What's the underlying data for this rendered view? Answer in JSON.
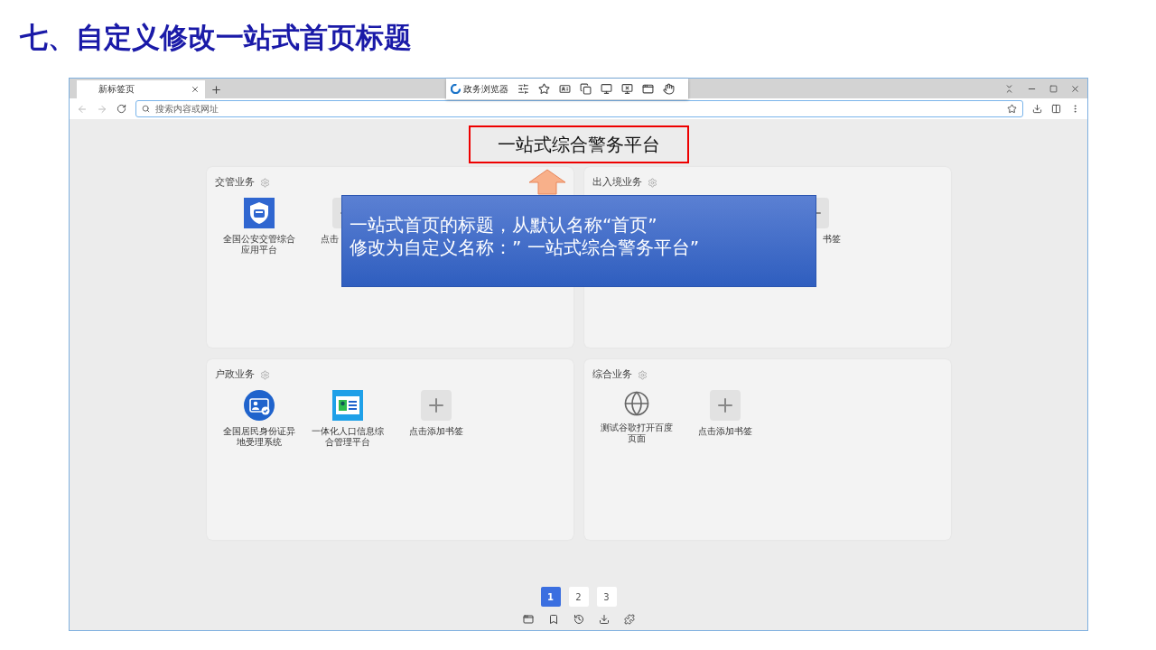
{
  "slide_title": "七、自定义修改一站式首页标题",
  "browser": {
    "tab": {
      "title": "新标签页",
      "selected": true
    },
    "toolbar": {
      "brand": "政务浏览器"
    },
    "address": {
      "placeholder": "搜索内容或网址"
    }
  },
  "page": {
    "title": "一站式综合警务平台",
    "cards": [
      {
        "title": "交管业务",
        "items": [
          {
            "kind": "shield",
            "label": "全国公安交管综合应用平台"
          },
          {
            "kind": "add",
            "label": "点击"
          }
        ]
      },
      {
        "title": "出入境业务",
        "items": [
          {
            "kind": "add",
            "label": "书签"
          }
        ]
      },
      {
        "title": "户政业务",
        "items": [
          {
            "kind": "idcard",
            "label": "全国居民身份证异地受理系统"
          },
          {
            "kind": "profile",
            "label": "一体化人口信息综合管理平台"
          },
          {
            "kind": "add",
            "label": "点击添加书签"
          }
        ]
      },
      {
        "title": "综合业务",
        "items": [
          {
            "kind": "globe",
            "label": "测试谷歌打开百度页面"
          },
          {
            "kind": "add",
            "label": "点击添加书签"
          }
        ]
      }
    ],
    "pagination": [
      {
        "label": "1",
        "selected": true
      },
      {
        "label": "2",
        "selected": false
      },
      {
        "label": "3",
        "selected": false
      }
    ]
  },
  "annotation": {
    "lines": [
      "一站式首页的标题，从默认名称“首页”",
      "修改为自定义名称：” 一站式综合警务平台”"
    ]
  }
}
